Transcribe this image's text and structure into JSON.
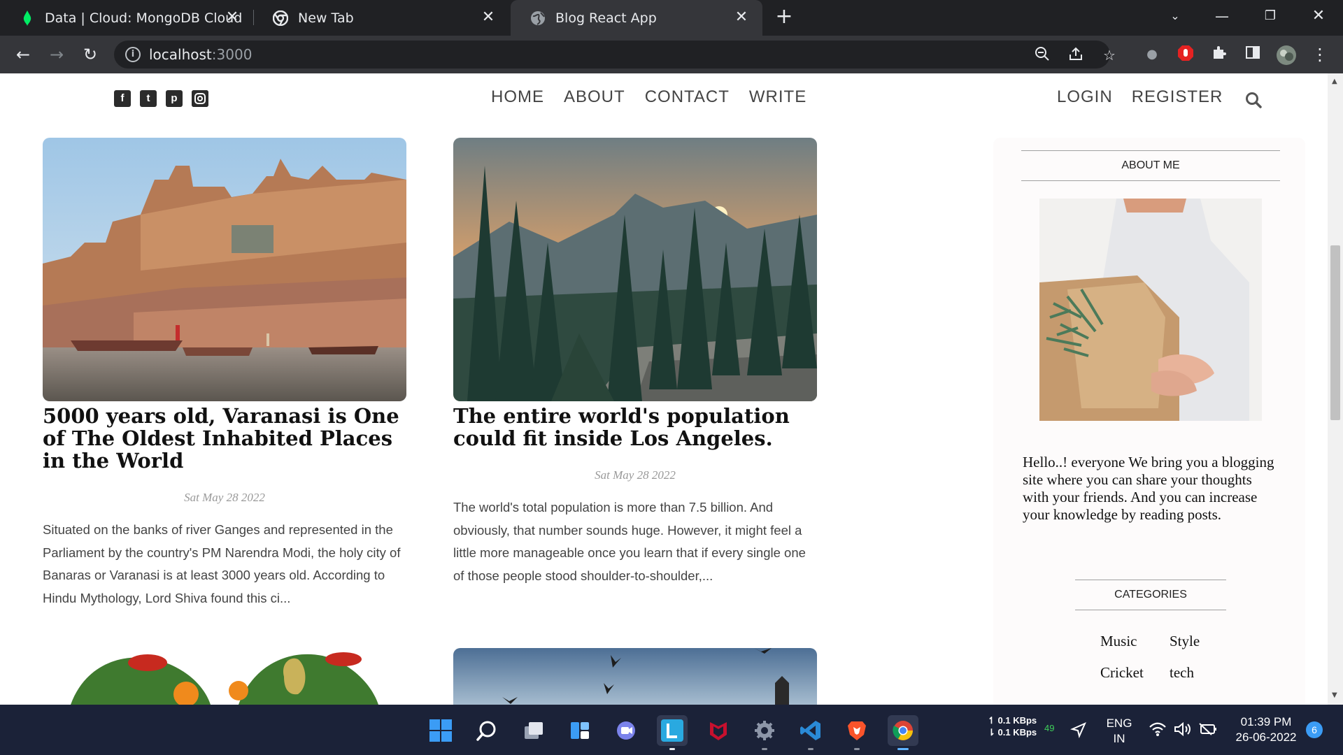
{
  "browser": {
    "tabs": [
      {
        "title": "Data | Cloud: MongoDB Cloud",
        "icon": "mongodb-leaf-icon"
      },
      {
        "title": "New Tab",
        "icon": "chrome-icon"
      },
      {
        "title": "Blog React App",
        "icon": "globe-icon"
      }
    ],
    "active_tab": 2,
    "url_host": "localhost",
    "url_port": ":3000"
  },
  "blog": {
    "social": [
      "facebook-icon",
      "twitter-icon",
      "pinterest-icon",
      "instagram-icon"
    ],
    "nav": [
      "HOME",
      "ABOUT",
      "CONTACT",
      "WRITE"
    ],
    "auth": [
      "LOGIN",
      "REGISTER"
    ],
    "posts": [
      {
        "title": "5000 years old, Varanasi is One of The Oldest Inhabited Places in the World",
        "date": "Sat May 28 2022",
        "desc": "Situated on the banks of river Ganges and represented in the Parliament by the country's PM Narendra Modi, the holy city of Banaras or Varanasi is at least 3000 years old. According to Hindu Mythology, Lord Shiva found this ci...",
        "image": "varanasi-ghats-photo"
      },
      {
        "title": "The entire world's population could fit inside Los Angeles.",
        "date": "Sat May 28 2022",
        "desc": "The world's total population is more than 7.5 billion. And obviously, that number sounds huge. However, it might feel a little more manageable once you learn that if every single one of those people stood shoulder-to-shoulder,...",
        "image": "pine-forest-sunset-photo"
      }
    ],
    "sidebar": {
      "about_title": "ABOUT ME",
      "about_text": "Hello..! everyone We bring you a blogging site where you can share your thoughts with your friends. And you can increase your knowledge by reading posts.",
      "categories_title": "CATEGORIES",
      "categories": [
        "Music",
        "Style",
        "Cricket",
        "tech"
      ]
    }
  },
  "taskbar": {
    "net_up": "0.1 KBps",
    "net_down": "0.1 KBps",
    "net_badge": "49",
    "lang": "ENG",
    "region": "IN",
    "time": "01:39 PM",
    "date": "26-06-2022",
    "notifications": "6",
    "apps": [
      "start-icon",
      "search-icon",
      "task-view-icon",
      "widgets-icon",
      "teams-chat-icon",
      "lens-app-icon",
      "mcafee-icon",
      "settings-icon",
      "vscode-icon",
      "brave-icon",
      "chrome-icon"
    ]
  },
  "colors": {
    "chrome_dark": "#202124",
    "chrome_tab": "#35363a",
    "taskbar": "#1b2238"
  }
}
